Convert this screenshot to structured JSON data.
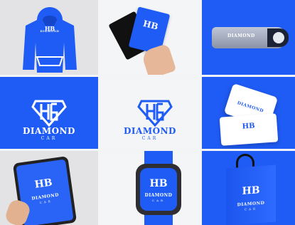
{
  "brand": {
    "name": "DIAMOND",
    "sub": "CAR",
    "colors": {
      "primary": "#1f5bf5",
      "light": "#ffffff"
    }
  },
  "mockups": [
    {
      "name": "hoodie"
    },
    {
      "name": "business-cards"
    },
    {
      "name": "usb-drive"
    },
    {
      "name": "logo-on-blue"
    },
    {
      "name": "logo-on-white"
    },
    {
      "name": "stationery-card"
    },
    {
      "name": "tablet"
    },
    {
      "name": "smartwatch"
    },
    {
      "name": "shopping-bag"
    }
  ]
}
